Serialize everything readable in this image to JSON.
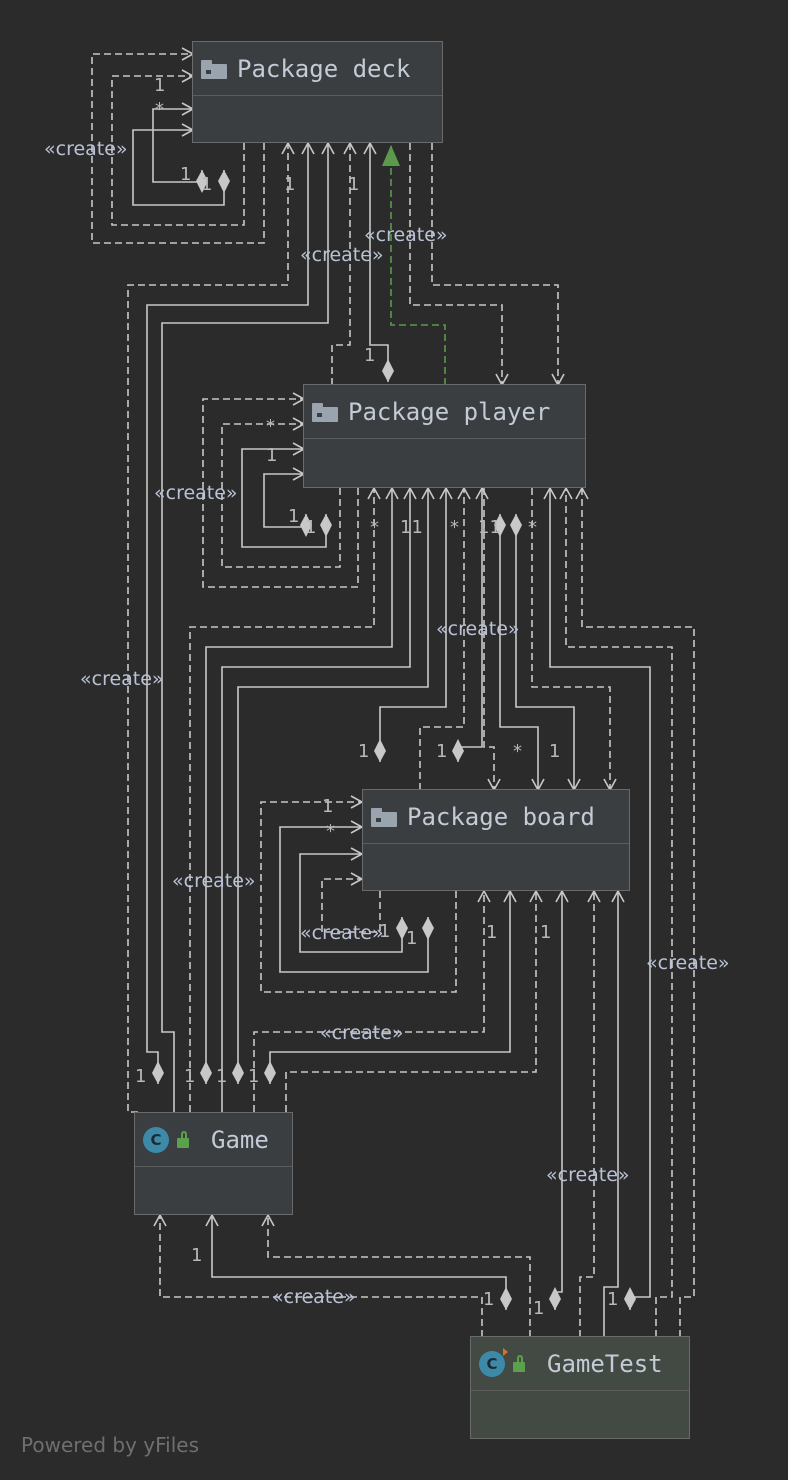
{
  "nodes": {
    "deck": {
      "label": "Package deck",
      "icon": "folder-icon"
    },
    "player": {
      "label": "Package player",
      "icon": "folder-icon"
    },
    "board": {
      "label": "Package board",
      "icon": "folder-icon"
    },
    "game": {
      "label": "Game",
      "icon": "class-icon",
      "icon_letter": "C",
      "access": "public-lock-icon"
    },
    "gametest": {
      "label": "GameTest",
      "icon": "test-class-icon",
      "icon_letter": "C",
      "access": "public-lock-icon"
    }
  },
  "stereotype": "«create»",
  "footer": "Powered by yFiles",
  "colors": {
    "background": "#2b2b2b",
    "node_fill": "#3b3e41",
    "test_node_fill": "#434a44",
    "edge": "#c8c8c8",
    "inheritance_edge": "#5a9a4a"
  }
}
